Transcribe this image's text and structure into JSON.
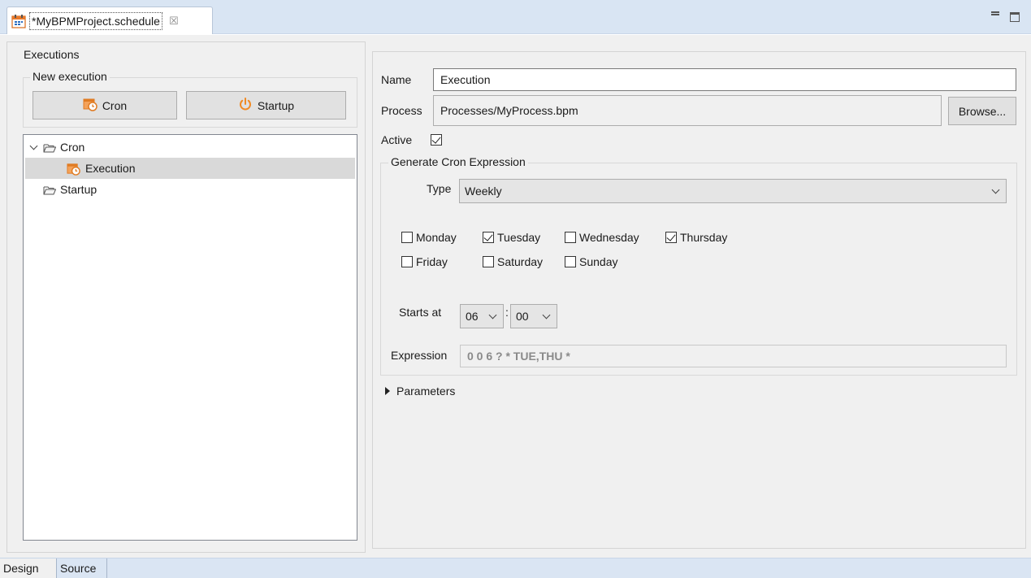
{
  "editor_tab": {
    "icon": "schedule-calendar-icon",
    "title": "*MyBPMProject.schedule",
    "close_glyph": "☒"
  },
  "window_controls": [
    "minimize-icon",
    "maximize-icon"
  ],
  "left": {
    "executions_legend": "Executions",
    "new_execution_legend": "New execution",
    "cron_button": "Cron",
    "startup_button": "Startup",
    "tree": [
      {
        "label": "Cron",
        "icon": "folder-icon",
        "expanded": true,
        "level": 0
      },
      {
        "label": "Execution",
        "icon": "cron-schedule-icon",
        "selected": true,
        "level": 1
      },
      {
        "label": "Startup",
        "icon": "folder-icon",
        "level": 0
      }
    ]
  },
  "right": {
    "name_label": "Name",
    "name_value": "Execution",
    "process_label": "Process",
    "process_value": "Processes/MyProcess.bpm",
    "browse_button": "Browse...",
    "active_label": "Active",
    "active_checked": true,
    "cron_group_legend": "Generate Cron Expression",
    "type_label": "Type",
    "type_value": "Weekly",
    "days": [
      {
        "label": "Monday",
        "checked": false
      },
      {
        "label": "Tuesday",
        "checked": true
      },
      {
        "label": "Wednesday",
        "checked": false
      },
      {
        "label": "Thursday",
        "checked": true
      },
      {
        "label": "Friday",
        "checked": false
      },
      {
        "label": "Saturday",
        "checked": false
      },
      {
        "label": "Sunday",
        "checked": false
      }
    ],
    "starts_at_label": "Starts at",
    "hour_value": "06",
    "time_separator": ":",
    "minute_value": "00",
    "expression_label": "Expression",
    "expression_value": "0 0 6 ? * TUE,THU *",
    "parameters_label": "Parameters"
  },
  "bottom_tabs": [
    "Design",
    "Source"
  ],
  "colors": {
    "tab_bar": "#d9e5f3",
    "panel_bg": "#f0f0f0",
    "accent_orange": "#f08a24",
    "selection": "#d9d9d9"
  }
}
